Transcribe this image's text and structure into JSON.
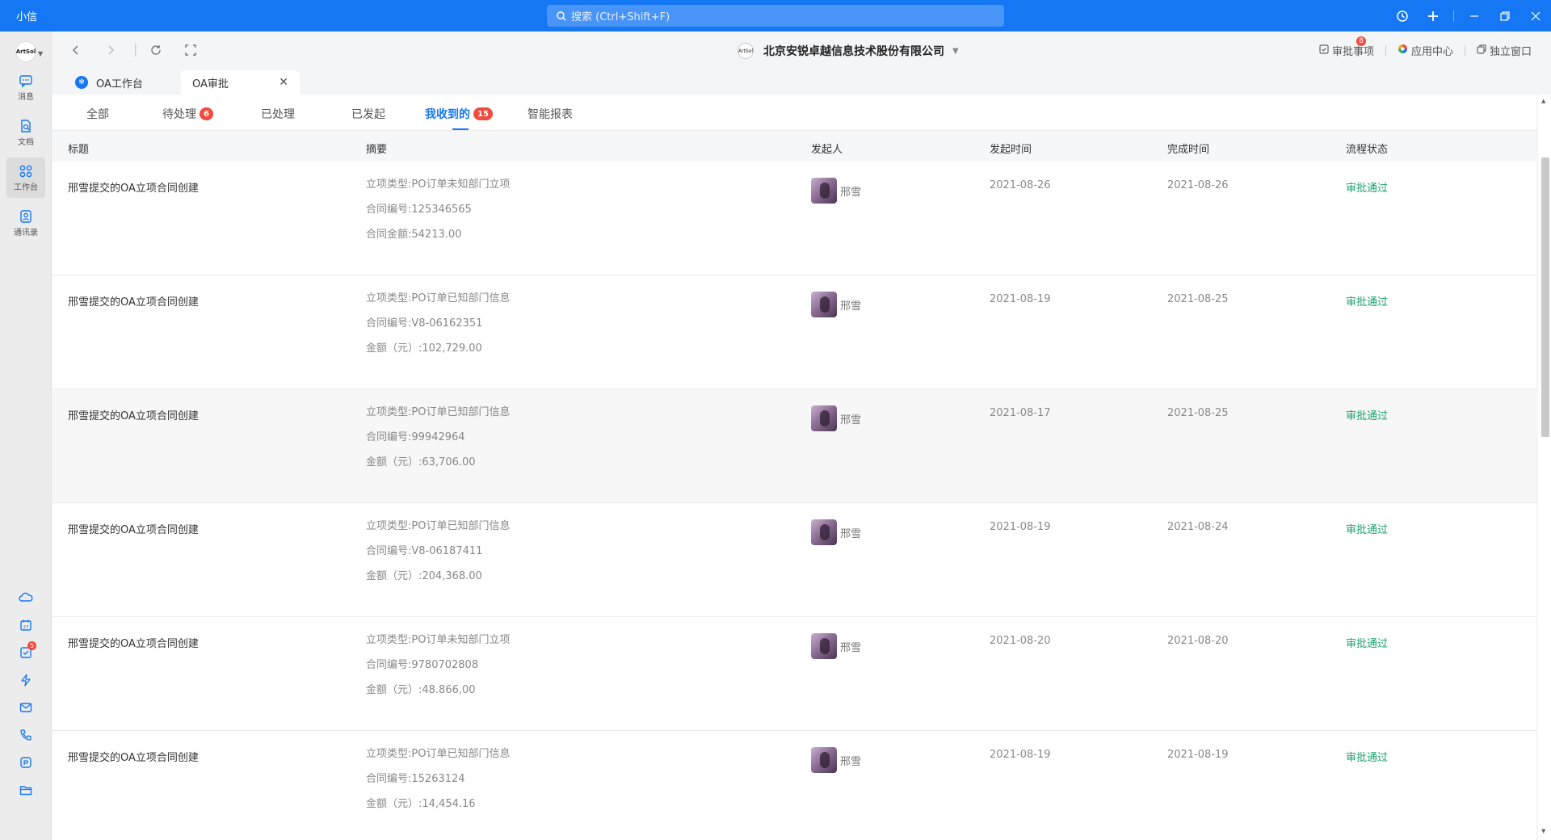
{
  "app": {
    "name": "小信"
  },
  "search": {
    "placeholder": "搜索 (Ctrl+Shift+F)"
  },
  "rail": {
    "logo_text": "ArtSol",
    "items": [
      {
        "label": "消息",
        "icon": "chat-icon"
      },
      {
        "label": "文档",
        "icon": "document-icon"
      },
      {
        "label": "工作台",
        "icon": "workbench-icon"
      },
      {
        "label": "通讯录",
        "icon": "contacts-icon"
      }
    ],
    "bottom_badge": "5"
  },
  "toolbar": {
    "company": "北京安锐卓越信息技术股份有限公司",
    "company_logo": "ArtSol",
    "approval_label": "审批事项",
    "approval_badge": "8",
    "app_center_label": "应用中心",
    "standalone_label": "独立窗口"
  },
  "page_tabs": [
    {
      "label": "OA工作台"
    },
    {
      "label": "OA审批"
    }
  ],
  "sub_tabs": {
    "all": "全部",
    "pending": "待处理",
    "pending_badge": "6",
    "processed": "已处理",
    "initiated": "已发起",
    "received": "我收到的",
    "received_badge": "15",
    "report": "智能报表"
  },
  "table": {
    "headers": {
      "title": "标题",
      "summary": "摘要",
      "initiator": "发起人",
      "start_time": "发起时间",
      "end_time": "完成时间",
      "status": "流程状态"
    },
    "rows": [
      {
        "title": "邢雪提交的OA立项合同创建",
        "s1": "立项类型:PO订单未知部门立项",
        "s2": "合同编号:125346565",
        "s3": "合同金额:54213.00",
        "initiator": "邢雪",
        "start": "2021-08-26",
        "end": "2021-08-26",
        "status": "审批通过"
      },
      {
        "title": "邢雪提交的OA立项合同创建",
        "s1": "立项类型:PO订单已知部门信息",
        "s2": "合同编号:V8-06162351",
        "s3": "金额（元）:102,729.00",
        "initiator": "邢雪",
        "start": "2021-08-19",
        "end": "2021-08-25",
        "status": "审批通过"
      },
      {
        "title": "邢雪提交的OA立项合同创建",
        "s1": "立项类型:PO订单已知部门信息",
        "s2": "合同编号:99942964",
        "s3": "金额（元）:63,706.00",
        "initiator": "邢雪",
        "start": "2021-08-17",
        "end": "2021-08-25",
        "status": "审批通过"
      },
      {
        "title": "邢雪提交的OA立项合同创建",
        "s1": "立项类型:PO订单已知部门信息",
        "s2": "合同编号:V8-06187411",
        "s3": "金额（元）:204,368.00",
        "initiator": "邢雪",
        "start": "2021-08-19",
        "end": "2021-08-24",
        "status": "审批通过"
      },
      {
        "title": "邢雪提交的OA立项合同创建",
        "s1": "立项类型:PO订单未知部门立项",
        "s2": "合同编号:9780702808",
        "s3": "金额（元）:48.866,00",
        "initiator": "邢雪",
        "start": "2021-08-20",
        "end": "2021-08-20",
        "status": "审批通过"
      },
      {
        "title": "邢雪提交的OA立项合同创建",
        "s1": "立项类型:PO订单已知部门信息",
        "s2": "合同编号:15263124",
        "s3": "金额（元）:14,454.16",
        "initiator": "邢雪",
        "start": "2021-08-19",
        "end": "2021-08-19",
        "status": "审批通过"
      }
    ]
  },
  "colors": {
    "brand": "#1677f5",
    "status_ok": "#1ca36c",
    "badge": "#f04b3f"
  }
}
